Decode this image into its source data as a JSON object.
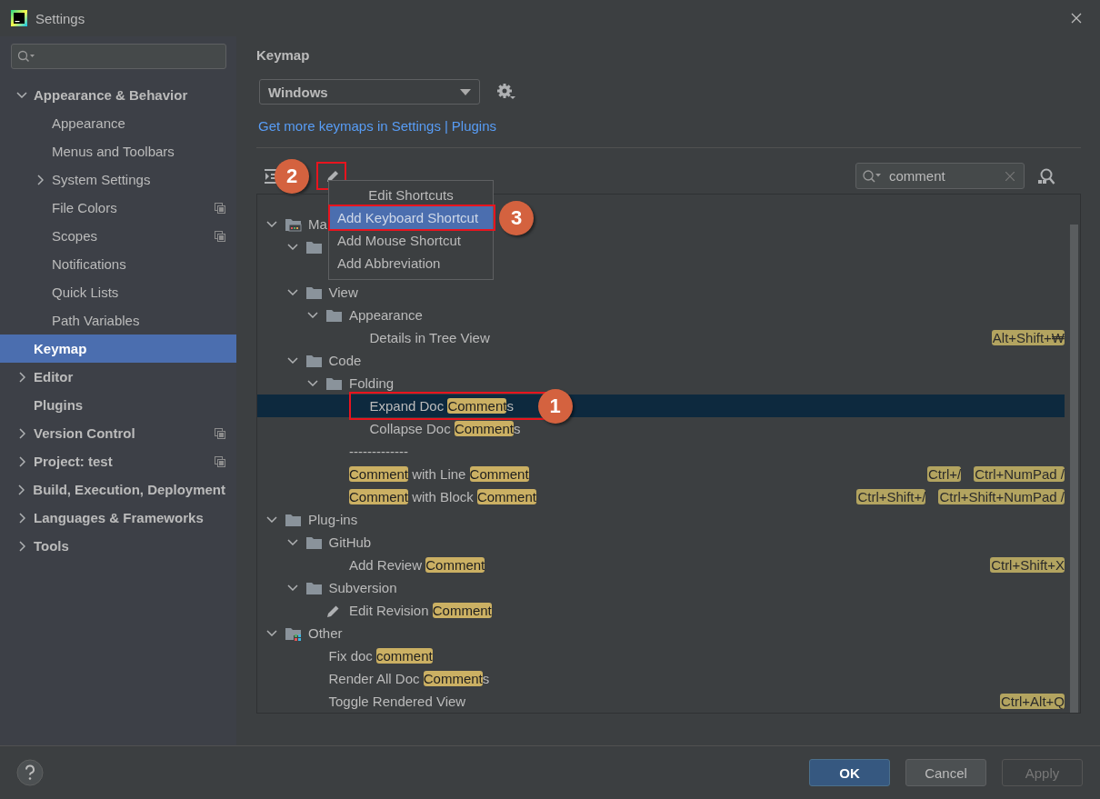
{
  "window": {
    "title": "Settings"
  },
  "sidebar": {
    "items": [
      {
        "label": "Appearance & Behavior",
        "expanded": true,
        "selected": false,
        "project_level": false,
        "children": [
          {
            "label": "Appearance",
            "selected": false,
            "project_level": false
          },
          {
            "label": "Menus and Toolbars",
            "selected": false,
            "project_level": false
          },
          {
            "label": "System Settings",
            "expanded": false,
            "selected": false,
            "project_level": false
          },
          {
            "label": "File Colors",
            "selected": false,
            "project_level": true
          },
          {
            "label": "Scopes",
            "selected": false,
            "project_level": true
          },
          {
            "label": "Notifications",
            "selected": false,
            "project_level": false
          },
          {
            "label": "Quick Lists",
            "selected": false,
            "project_level": false
          },
          {
            "label": "Path Variables",
            "selected": false,
            "project_level": false
          }
        ]
      },
      {
        "label": "Keymap",
        "selected": true,
        "project_level": false
      },
      {
        "label": "Editor",
        "expanded": false,
        "selected": false,
        "project_level": false
      },
      {
        "label": "Plugins",
        "selected": false,
        "project_level": false
      },
      {
        "label": "Version Control",
        "expanded": false,
        "selected": false,
        "project_level": true
      },
      {
        "label": "Project: test",
        "expanded": false,
        "selected": false,
        "project_level": true
      },
      {
        "label": "Build, Execution, Deployment",
        "expanded": false,
        "selected": false,
        "project_level": false
      },
      {
        "label": "Languages & Frameworks",
        "expanded": false,
        "selected": false,
        "project_level": false
      },
      {
        "label": "Tools",
        "expanded": false,
        "selected": false,
        "project_level": false
      }
    ]
  },
  "content": {
    "title": "Keymap",
    "keymap_select": {
      "value": "Windows"
    },
    "links": {
      "items": [
        "Get more keymaps in Settings",
        "Plugins"
      ],
      "separator": "|"
    },
    "edit_button": {
      "marked": true,
      "callout": "2"
    },
    "filter": {
      "value": "comment"
    },
    "tree": {
      "items": [
        {
          "kind": "menus",
          "expanded": true,
          "selected": false,
          "label": [
            {
              "text": "Ma",
              "match": false
            }
          ],
          "children": [
            {
              "kind": "folder",
              "expanded": true,
              "selected": false,
              "children": [
                {
                  "kind": "hidden"
                }
              ]
            },
            {
              "kind": "folder",
              "expanded": true,
              "selected": false,
              "label": [
                {
                  "text": "View",
                  "match": false
                }
              ],
              "children": [
                {
                  "kind": "folder",
                  "expanded": true,
                  "selected": false,
                  "label": [
                    {
                      "text": "Appearance",
                      "match": false
                    }
                  ],
                  "children": [
                    {
                      "kind": "action",
                      "selected": false,
                      "label": [
                        {
                          "text": "Details in Tree View",
                          "match": false
                        }
                      ],
                      "shortcuts": [
                        "Alt+Shift+₩"
                      ]
                    }
                  ]
                }
              ]
            },
            {
              "kind": "folder",
              "expanded": true,
              "selected": false,
              "label": [
                {
                  "text": "Code",
                  "match": false
                }
              ],
              "children": [
                {
                  "kind": "folder",
                  "expanded": true,
                  "selected": false,
                  "label": [
                    {
                      "text": "Folding",
                      "match": false
                    }
                  ],
                  "children": [
                    {
                      "kind": "action",
                      "selected": true,
                      "marked": true,
                      "callout": "1",
                      "label": [
                        {
                          "text": "Expand Doc ",
                          "match": false
                        },
                        {
                          "text": "Comment",
                          "match": true
                        },
                        {
                          "text": "s",
                          "match": false
                        }
                      ]
                    },
                    {
                      "kind": "action",
                      "selected": false,
                      "label": [
                        {
                          "text": "Collapse Doc ",
                          "match": false
                        },
                        {
                          "text": "Comment",
                          "match": true
                        },
                        {
                          "text": "s",
                          "match": false
                        }
                      ]
                    }
                  ]
                },
                {
                  "kind": "separator",
                  "label": [
                    {
                      "text": "-------------",
                      "match": false
                    }
                  ]
                },
                {
                  "kind": "action",
                  "selected": false,
                  "label": [
                    {
                      "text": "Comment",
                      "match": true
                    },
                    {
                      "text": " with Line ",
                      "match": false
                    },
                    {
                      "text": "Comment",
                      "match": true
                    }
                  ],
                  "shortcuts": [
                    "Ctrl+/",
                    "Ctrl+NumPad /"
                  ]
                },
                {
                  "kind": "action",
                  "selected": false,
                  "label": [
                    {
                      "text": "Comment",
                      "match": true
                    },
                    {
                      "text": " with Block ",
                      "match": false
                    },
                    {
                      "text": "Comment",
                      "match": true
                    }
                  ],
                  "shortcuts": [
                    "Ctrl+Shift+/",
                    "Ctrl+Shift+NumPad /"
                  ]
                }
              ]
            }
          ]
        },
        {
          "kind": "folder",
          "expanded": true,
          "selected": false,
          "label": [
            {
              "text": "Plug-ins",
              "match": false
            }
          ],
          "children": [
            {
              "kind": "folder",
              "expanded": true,
              "selected": false,
              "label": [
                {
                  "text": "GitHub",
                  "match": false
                }
              ],
              "children": [
                {
                  "kind": "action",
                  "selected": false,
                  "label": [
                    {
                      "text": "Add Review ",
                      "match": false
                    },
                    {
                      "text": "Comment",
                      "match": true
                    }
                  ],
                  "shortcuts": [
                    "Ctrl+Shift+X"
                  ]
                }
              ]
            },
            {
              "kind": "folder",
              "expanded": true,
              "selected": false,
              "label": [
                {
                  "text": "Subversion",
                  "match": false
                }
              ],
              "children": [
                {
                  "kind": "edited",
                  "selected": false,
                  "label": [
                    {
                      "text": "Edit Revision ",
                      "match": false
                    },
                    {
                      "text": "Comment",
                      "match": true
                    }
                  ]
                }
              ]
            }
          ]
        },
        {
          "kind": "other",
          "expanded": true,
          "selected": false,
          "label": [
            {
              "text": "Other",
              "match": false
            }
          ],
          "children": [
            {
              "kind": "action",
              "selected": false,
              "label": [
                {
                  "text": "Fix doc ",
                  "match": false
                },
                {
                  "text": "comment",
                  "match": true
                }
              ]
            },
            {
              "kind": "action",
              "selected": false,
              "label": [
                {
                  "text": "Render All Doc ",
                  "match": false
                },
                {
                  "text": "Comment",
                  "match": true
                },
                {
                  "text": "s",
                  "match": false
                }
              ]
            },
            {
              "kind": "action",
              "selected": false,
              "label": [
                {
                  "text": "Toggle Rendered View",
                  "match": false
                }
              ],
              "shortcuts": [
                "Ctrl+Alt+Q"
              ]
            }
          ]
        }
      ]
    },
    "popup_menu": {
      "items": [
        {
          "label": "Edit Shortcuts",
          "kind": "header",
          "selected": false
        },
        {
          "label": "Add Keyboard Shortcut",
          "kind": "item",
          "selected": true,
          "marked": true,
          "callout": "3"
        },
        {
          "label": "Add Mouse Shortcut",
          "kind": "item",
          "selected": false
        },
        {
          "label": "Add Abbreviation",
          "kind": "item",
          "selected": false
        }
      ]
    }
  },
  "footer": {
    "buttons": [
      {
        "label": "OK",
        "kind": "primary",
        "disabled": false
      },
      {
        "label": "Cancel",
        "kind": "normal",
        "disabled": false
      },
      {
        "label": "Apply",
        "kind": "normal",
        "disabled": true
      }
    ]
  }
}
